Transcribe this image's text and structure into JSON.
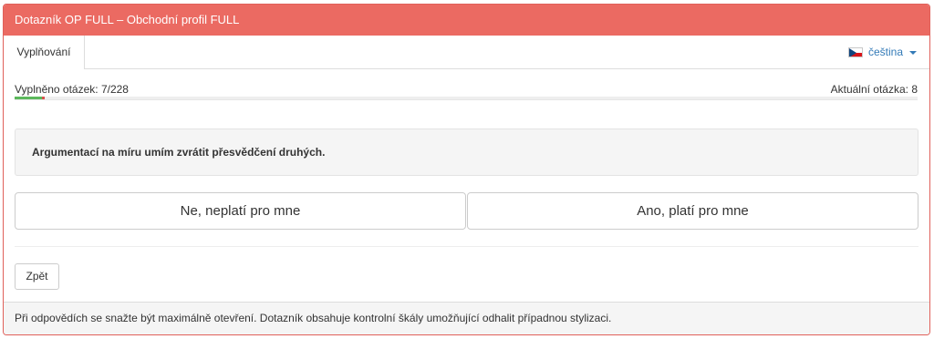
{
  "header": {
    "title": "Dotazník OP FULL – Obchodní profil FULL"
  },
  "tabs": [
    {
      "label": "Vyplňování",
      "active": true
    }
  ],
  "language": {
    "label": "čeština",
    "flag_icon": "czech-flag-icon"
  },
  "progress": {
    "filled_label": "Vyplněno otázek: 7/228",
    "filled": 7,
    "total": 228,
    "current_label": "Aktuální otázka: 8",
    "fill_color": "#5cb85c",
    "current_color": "#d9534f"
  },
  "question": {
    "text": "Argumentací na míru umím zvrátit přesvědčení druhých."
  },
  "answers": {
    "no_label": "Ne, neplatí pro mne",
    "yes_label": "Ano, platí pro mne"
  },
  "back": {
    "label": "Zpět"
  },
  "footer": {
    "text": "Při odpovědích se snažte být maximálně otevření. Dotazník obsahuje kontrolní škály umožňující odhalit případnou stylizaci."
  },
  "colors": {
    "accent": "#eb6a62",
    "link": "#337ab7"
  }
}
